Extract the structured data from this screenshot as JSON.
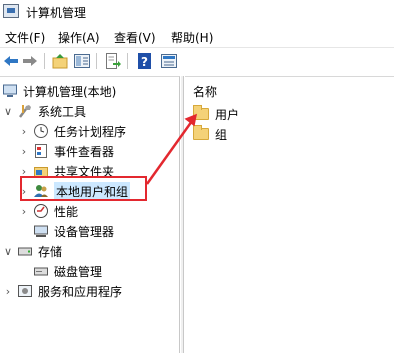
{
  "window": {
    "title": "计算机管理"
  },
  "menu": [
    "文件(F)",
    "操作(A)",
    "查看(V)",
    "帮助(H)"
  ],
  "toolbar": {
    "icons": [
      "back-arrow-icon",
      "forward-arrow-icon",
      "up-folder-icon",
      "show-hide-tree-icon",
      "export-list-icon",
      "help-icon",
      "properties-icon"
    ]
  },
  "tree": {
    "root": "计算机管理(本地)",
    "system_tools": "系统工具",
    "task_scheduler": "任务计划程序",
    "event_viewer": "事件查看器",
    "shared_folders": "共享文件夹",
    "local_users_groups": "本地用户和组",
    "performance": "性能",
    "device_manager": "设备管理器",
    "storage": "存储",
    "disk_management": "磁盘管理",
    "services_apps": "服务和应用程序"
  },
  "list": {
    "column": "名称",
    "items": [
      "用户",
      "组"
    ]
  },
  "colors": {
    "annotation": "#e3282f",
    "selection": "#cce8ff"
  }
}
